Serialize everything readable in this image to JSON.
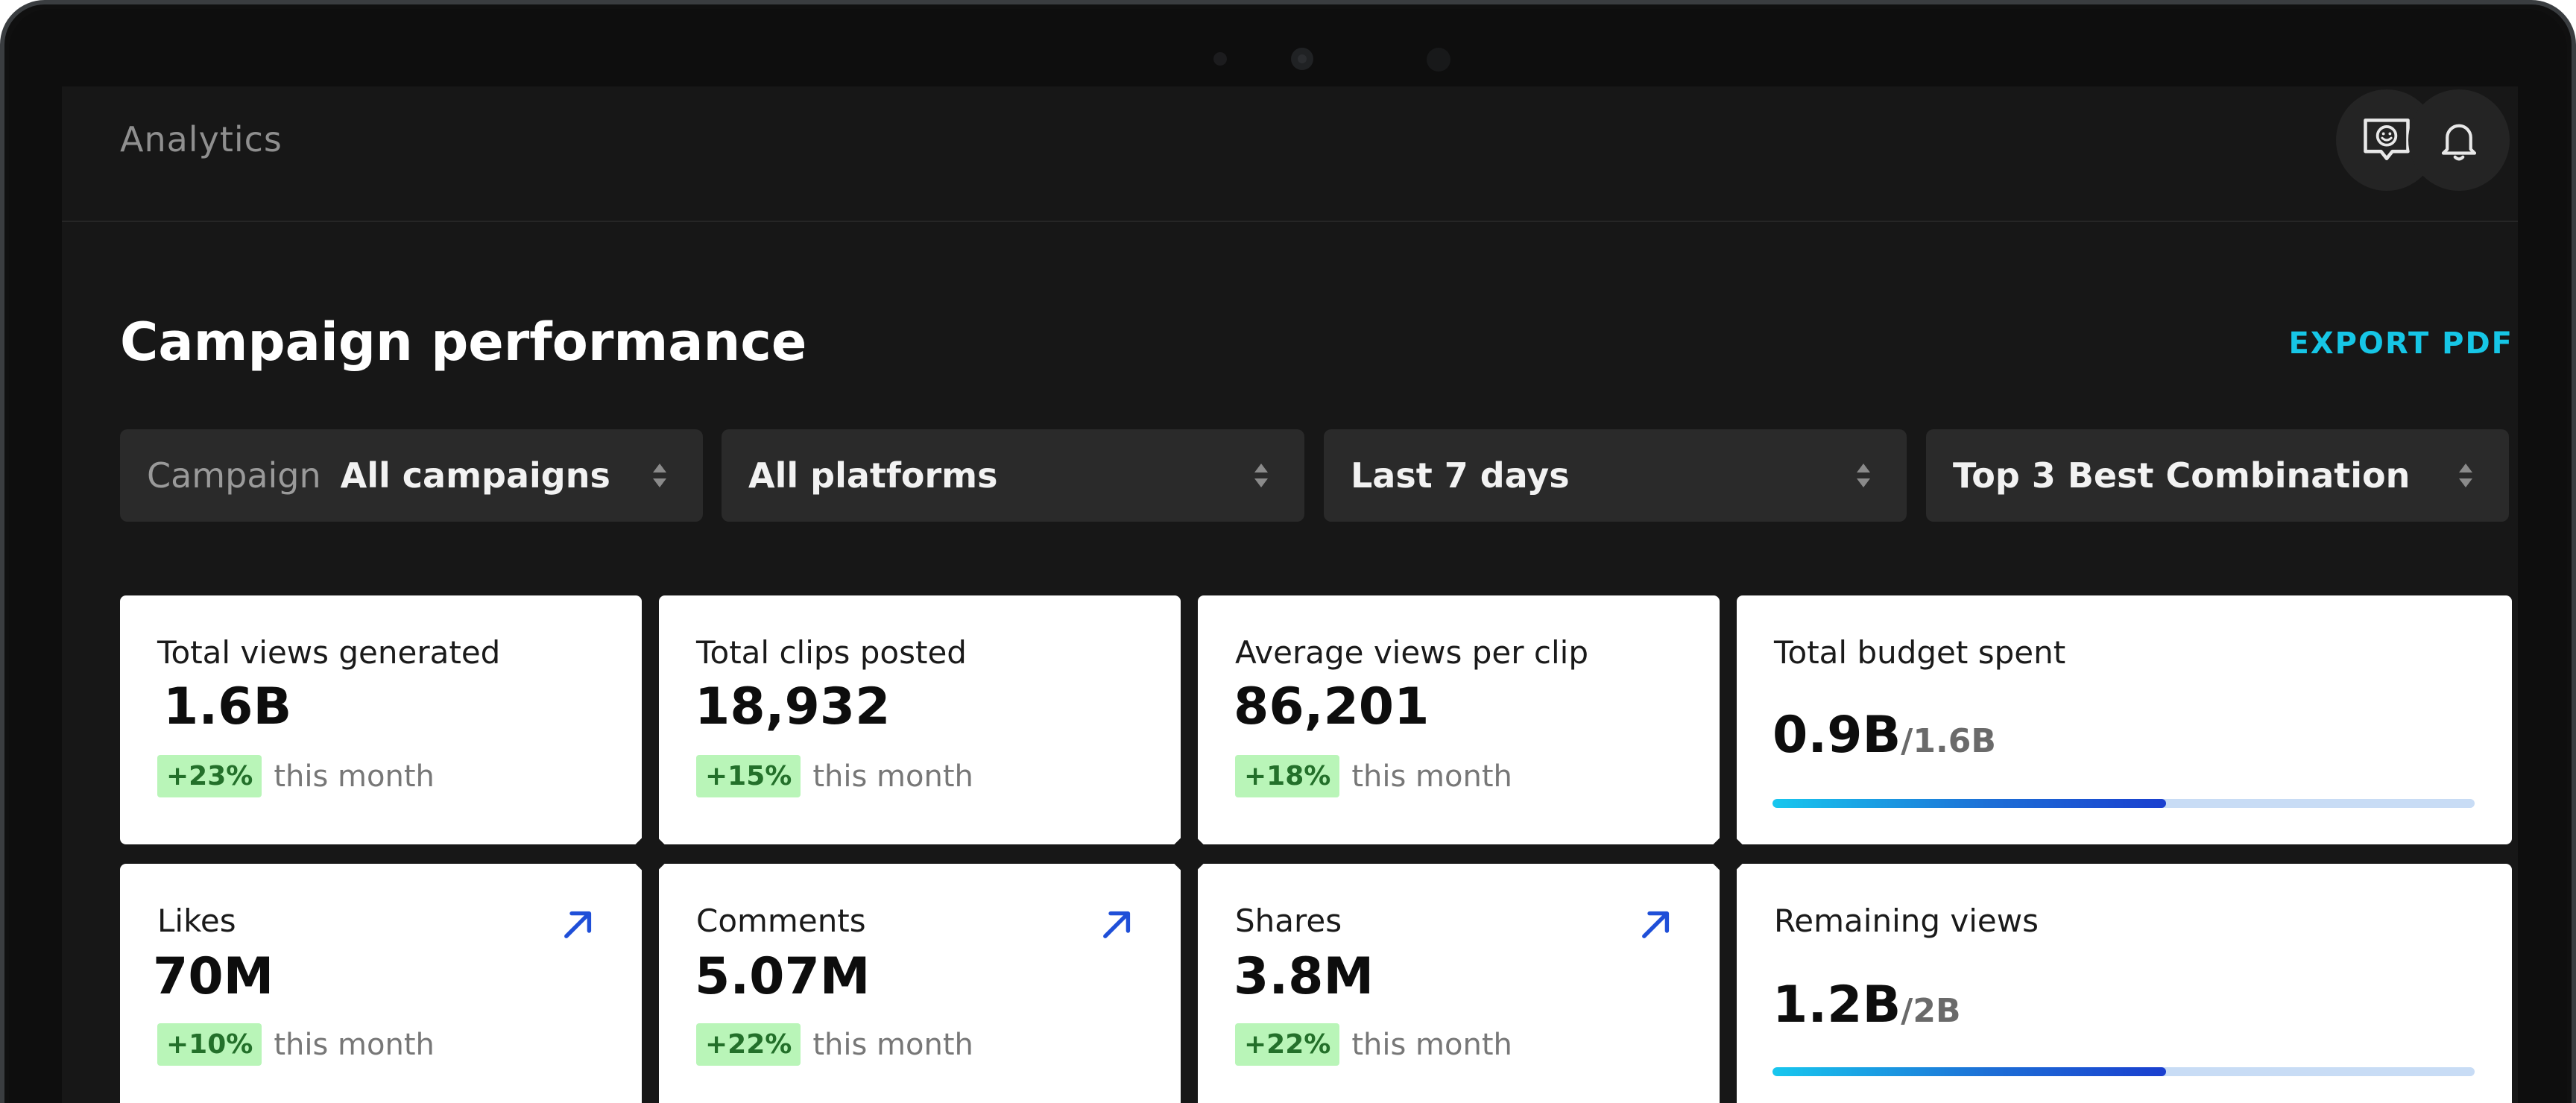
{
  "app": {
    "title": "Analytics"
  },
  "header_icons": {
    "feedback": "feedback-chat-icon",
    "notifications": "bell-icon"
  },
  "page": {
    "title": "Campaign performance",
    "export_label": "EXPORT PDF"
  },
  "filters": [
    {
      "label": "Campaign",
      "value": "All campaigns"
    },
    {
      "label": "",
      "value": "All platforms"
    },
    {
      "label": "",
      "value": "Last 7 days"
    },
    {
      "label": "",
      "value": "Top 3 Best Combination"
    }
  ],
  "metrics_row1": [
    {
      "label": "Total views generated",
      "value": "1.6B",
      "delta": "+23%",
      "delta_suffix": "this month"
    },
    {
      "label": "Total clips posted",
      "value": "18,932",
      "delta": "+15%",
      "delta_suffix": "this month"
    },
    {
      "label": "Average views per clip",
      "value": "86,201",
      "delta": "+18%",
      "delta_suffix": "this month"
    }
  ],
  "budget": {
    "label": "Total budget spent",
    "value": "0.9B",
    "total": "/1.6B",
    "progress_fraction": 0.56
  },
  "metrics_row2": [
    {
      "label": "Likes",
      "value": "70M",
      "delta": "+10%",
      "delta_suffix": "this month"
    },
    {
      "label": "Comments",
      "value": "5.07M",
      "delta": "+22%",
      "delta_suffix": "this month"
    },
    {
      "label": "Shares",
      "value": "3.8M",
      "delta": "+22%",
      "delta_suffix": "this month"
    }
  ],
  "remaining": {
    "label": "Remaining views",
    "value": "1.2B",
    "total": "/2B",
    "progress_fraction": 0.56
  },
  "colors": {
    "accent": "#16c6e6",
    "delta_bg": "#b9f5b8",
    "delta_text": "#23702a",
    "arrow": "#1f4fd8",
    "screen_bg": "#171717",
    "card_bg": "#ffffff"
  }
}
